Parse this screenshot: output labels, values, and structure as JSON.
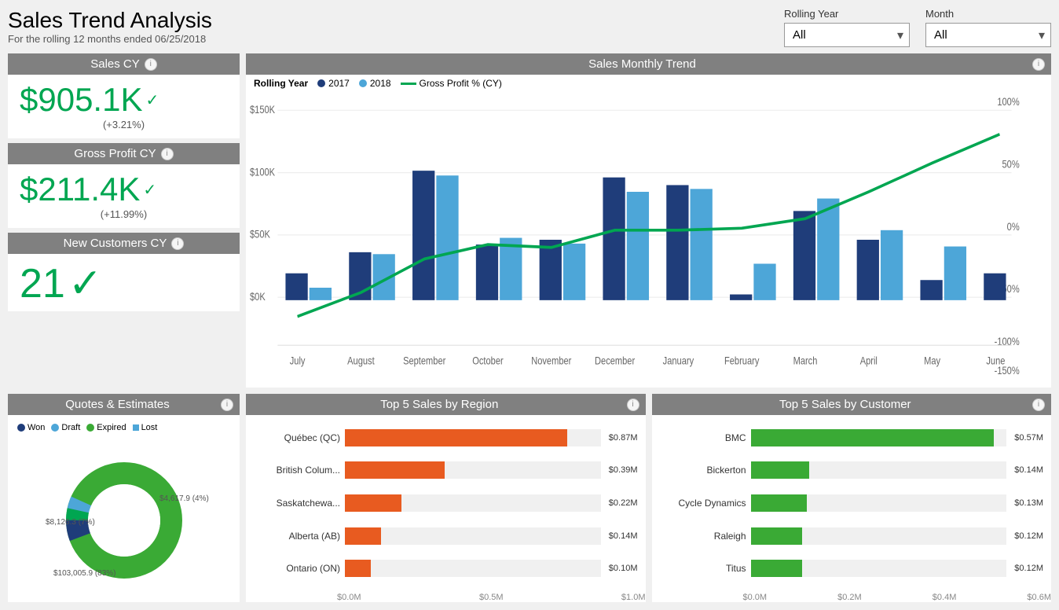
{
  "header": {
    "title": "Sales Trend Analysis",
    "subtitle": "For the rolling 12 months ended 06/25/2018",
    "filter_rolling_year_label": "Rolling Year",
    "filter_rolling_year_value": "All",
    "filter_month_label": "Month",
    "filter_month_value": "All"
  },
  "kpi_sales": {
    "title": "Sales CY",
    "value": "$905.1K",
    "change": "(+3.21%)"
  },
  "kpi_gross_profit": {
    "title": "Gross Profit CY",
    "value": "$211.4K",
    "change": "(+11.99%)"
  },
  "kpi_new_customers": {
    "title": "New Customers CY",
    "value": "21"
  },
  "chart_main": {
    "title": "Sales Monthly Trend",
    "legend": {
      "year2017_label": "2017",
      "year2018_label": "2018",
      "gross_profit_label": "Gross Profit % (CY)"
    }
  },
  "quotes": {
    "title": "Quotes & Estimates",
    "legend_won": "Won",
    "legend_draft": "Draft",
    "legend_expired": "Expired",
    "legend_lost": "Lost",
    "won_value": "$103,005.9 (83%)",
    "draft_value": "$8,126.3 (7%)",
    "lost_value": "$4,617.9 (4%)"
  },
  "region": {
    "title": "Top 5 Sales by Region",
    "items": [
      {
        "label": "Québec (QC)",
        "value": "$0.87M",
        "pct": 87
      },
      {
        "label": "British Colum...",
        "value": "$0.39M",
        "pct": 39
      },
      {
        "label": "Saskatchewa...",
        "value": "$0.22M",
        "pct": 22
      },
      {
        "label": "Alberta (AB)",
        "value": "$0.14M",
        "pct": 14
      },
      {
        "label": "Ontario (ON)",
        "value": "$0.10M",
        "pct": 10
      }
    ],
    "axis_labels": [
      "$0.0M",
      "$0.5M",
      "$1.0M"
    ]
  },
  "customer": {
    "title": "Top 5 Sales by Customer",
    "items": [
      {
        "label": "BMC",
        "value": "$0.57M",
        "pct": 95
      },
      {
        "label": "Bickerton",
        "value": "$0.14M",
        "pct": 23
      },
      {
        "label": "Cycle Dynamics",
        "value": "$0.13M",
        "pct": 22
      },
      {
        "label": "Raleigh",
        "value": "$0.12M",
        "pct": 20
      },
      {
        "label": "Titus",
        "value": "$0.12M",
        "pct": 20
      }
    ],
    "axis_labels": [
      "$0.0M",
      "$0.2M",
      "$0.4M",
      "$0.6M"
    ]
  },
  "colors": {
    "header_bg": "#808080",
    "blue2017": "#1f3d7a",
    "blue2018": "#4da6d8",
    "green_line": "#00a651",
    "orange_bar": "#e85b20",
    "green_bar": "#3aaa35",
    "donut_won": "#3aaa35",
    "donut_draft": "#1f3d7a",
    "donut_expired": "#00a651",
    "donut_lost": "#4da6d8"
  }
}
